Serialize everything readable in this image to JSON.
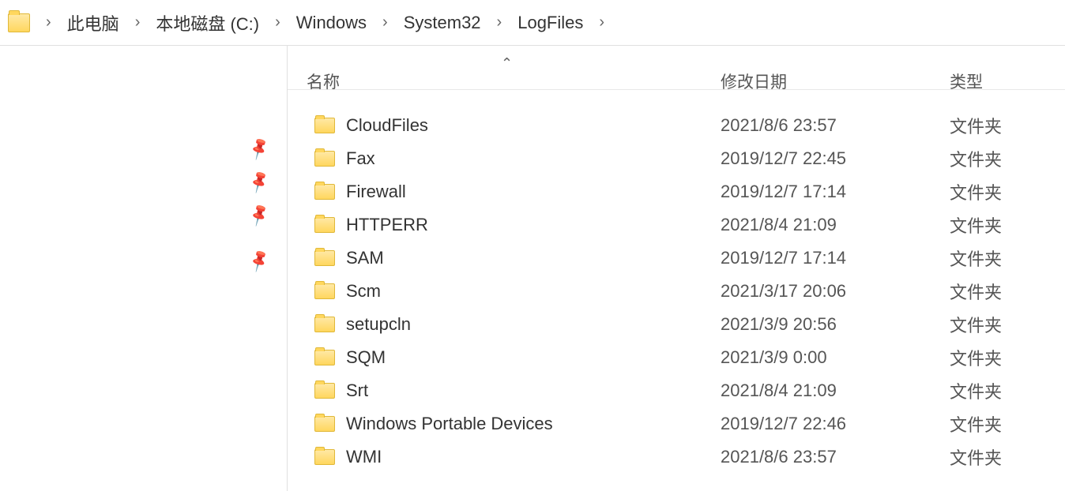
{
  "breadcrumb": {
    "items": [
      "此电脑",
      "本地磁盘 (C:)",
      "Windows",
      "System32",
      "LogFiles"
    ]
  },
  "columns": {
    "name": "名称",
    "date": "修改日期",
    "type": "类型"
  },
  "rows": [
    {
      "name": "CloudFiles",
      "date": "2021/8/6 23:57",
      "type": "文件夹"
    },
    {
      "name": "Fax",
      "date": "2019/12/7 22:45",
      "type": "文件夹"
    },
    {
      "name": "Firewall",
      "date": "2019/12/7 17:14",
      "type": "文件夹"
    },
    {
      "name": "HTTPERR",
      "date": "2021/8/4 21:09",
      "type": "文件夹"
    },
    {
      "name": "SAM",
      "date": "2019/12/7 17:14",
      "type": "文件夹"
    },
    {
      "name": "Scm",
      "date": "2021/3/17 20:06",
      "type": "文件夹"
    },
    {
      "name": "setupcln",
      "date": "2021/3/9 20:56",
      "type": "文件夹"
    },
    {
      "name": "SQM",
      "date": "2021/3/9 0:00",
      "type": "文件夹"
    },
    {
      "name": "Srt",
      "date": "2021/8/4 21:09",
      "type": "文件夹"
    },
    {
      "name": "Windows Portable Devices",
      "date": "2019/12/7 22:46",
      "type": "文件夹"
    },
    {
      "name": "WMI",
      "date": "2021/8/6 23:57",
      "type": "文件夹"
    }
  ],
  "pins": [
    0,
    1,
    2,
    3
  ],
  "collapseGlyph": "⌃"
}
